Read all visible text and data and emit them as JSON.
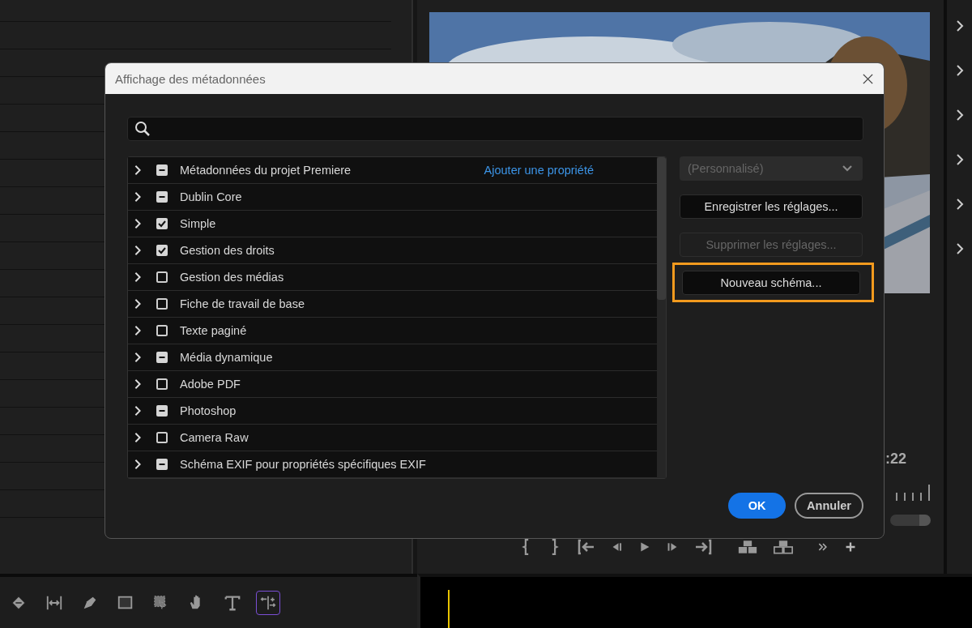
{
  "monitor": {
    "timecode": ":22"
  },
  "toolbar": {
    "tools": [
      {
        "selected": false
      },
      {
        "selected": false
      },
      {
        "selected": false
      },
      {
        "selected": false
      },
      {
        "selected": false
      },
      {
        "selected": false
      },
      {
        "selected": false
      },
      {
        "selected": true
      }
    ]
  },
  "dialog": {
    "title": "Affichage des métadonnées",
    "schemas": [
      {
        "label": "Métadonnées du projet Premiere",
        "checked": false,
        "partial": true,
        "expanded": false,
        "action": "Ajouter une propriété"
      },
      {
        "label": "Dublin Core",
        "checked": false,
        "partial": true,
        "expanded": false
      },
      {
        "label": "Simple",
        "checked": true,
        "partial": false,
        "expanded": false
      },
      {
        "label": "Gestion des droits",
        "checked": true,
        "partial": false,
        "expanded": false
      },
      {
        "label": "Gestion des médias",
        "checked": false,
        "partial": false,
        "expanded": false
      },
      {
        "label": "Fiche de travail de base",
        "checked": false,
        "partial": false,
        "expanded": false
      },
      {
        "label": "Texte paginé",
        "checked": false,
        "partial": false,
        "expanded": false
      },
      {
        "label": "Média dynamique",
        "checked": false,
        "partial": true,
        "expanded": false
      },
      {
        "label": "Adobe PDF",
        "checked": false,
        "partial": false,
        "expanded": false
      },
      {
        "label": "Photoshop",
        "checked": false,
        "partial": true,
        "expanded": false
      },
      {
        "label": "Camera Raw",
        "checked": false,
        "partial": false,
        "expanded": false
      },
      {
        "label": "Schéma EXIF pour propriétés spécifiques EXIF",
        "checked": false,
        "partial": true,
        "expanded": false
      }
    ],
    "preset": {
      "value": "(Personnalisé)",
      "disabled": true
    },
    "buttons": [
      {
        "label": "Enregistrer les réglages...",
        "disabled": false,
        "highlighted": false
      },
      {
        "label": "Supprimer les réglages...",
        "disabled": true,
        "highlighted": false
      },
      {
        "label": "Nouveau schéma...",
        "disabled": false,
        "highlighted": true
      }
    ],
    "footer": [
      {
        "label": "OK",
        "kind": "primary"
      },
      {
        "label": "Annuler",
        "kind": "secondary"
      }
    ]
  }
}
